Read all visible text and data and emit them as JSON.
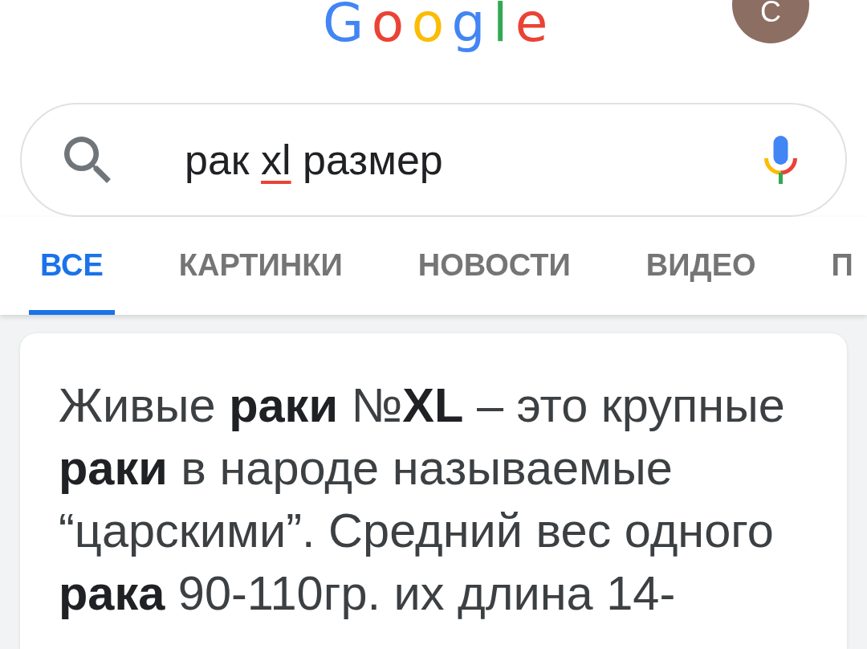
{
  "logo": {
    "text": "Google"
  },
  "account": {
    "initial": "С"
  },
  "search": {
    "query": [
      {
        "text": "рак",
        "misspelled": false
      },
      {
        "text": "xl",
        "misspelled": true
      },
      {
        "text": "размер",
        "misspelled": false
      }
    ]
  },
  "tabs": [
    {
      "label": "ВСЕ",
      "selected": true
    },
    {
      "label": "КАРТИНКИ",
      "selected": false
    },
    {
      "label": "НОВОСТИ",
      "selected": false
    },
    {
      "label": "ВИДЕО",
      "selected": false
    },
    {
      "label": "П",
      "selected": false
    }
  ],
  "result": {
    "snippet": "Живые **раки** №**XL** – это крупные **раки** в народе называемые “царскими”. Средний вес одного **рака** 90-110гр. их длина 14-"
  }
}
